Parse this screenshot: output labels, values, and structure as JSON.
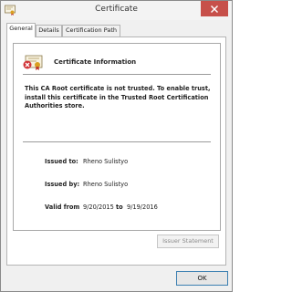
{
  "window": {
    "title": "Certificate",
    "close_icon": "close-icon"
  },
  "tabs": [
    {
      "label": "General",
      "active": true
    },
    {
      "label": "Details",
      "active": false
    },
    {
      "label": "Certification Path",
      "active": false
    }
  ],
  "info": {
    "title": "Certificate Information",
    "warning": "This CA Root certificate is not trusted. To enable trust, install this certificate in the Trusted Root Certification Authorities store.",
    "issued_to_label": "Issued to:",
    "issued_to": "Rheno Sulistyo",
    "issued_by_label": "Issued by:",
    "issued_by": "Rheno Sulistyo",
    "valid_from_label": "Valid from",
    "valid_from": "9/20/2015",
    "to_label": "to",
    "valid_to": "9/19/2016"
  },
  "buttons": {
    "issuer_statement": "Issuer Statement",
    "ok": "OK"
  },
  "colors": {
    "close_button": "#c7504a",
    "ok_border": "#3c7fb1"
  }
}
